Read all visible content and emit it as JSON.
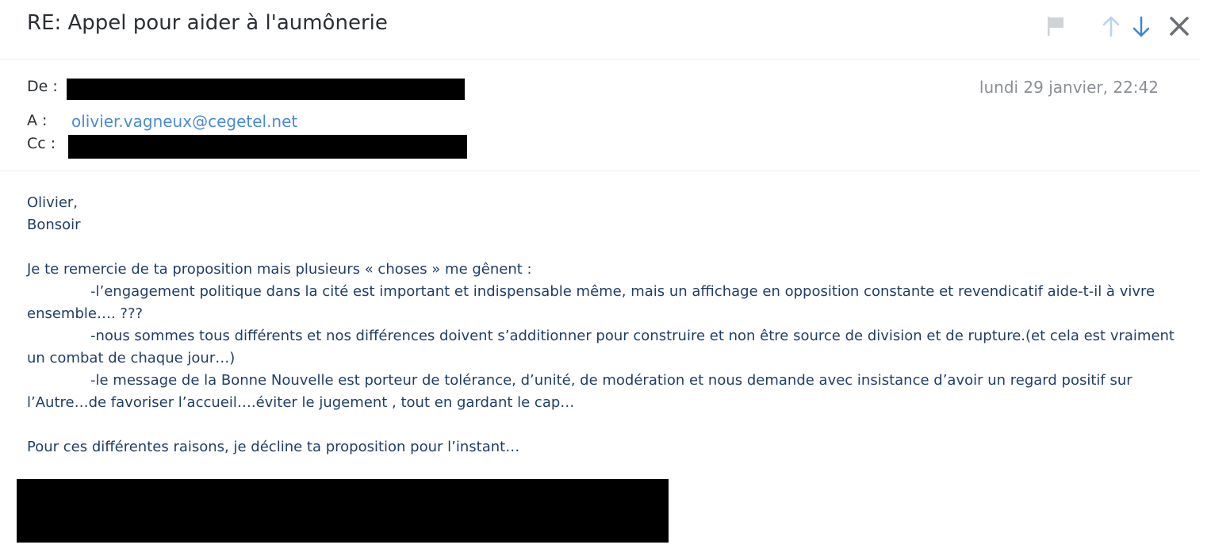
{
  "email": {
    "subject": "RE: Appel pour aider à l'aumônerie",
    "from_label": "De :",
    "to_label": "A :",
    "to_address": "olivier.vagneux@cegetel.net",
    "cc_label": "Cc :",
    "date": "lundi 29 janvier, 22:42"
  },
  "toolbar": {
    "flag_icon": "flag-icon",
    "prev_icon": "arrow-up-icon",
    "next_icon": "arrow-down-icon",
    "close_icon": "close-icon",
    "colors": {
      "flag": "#cfd3d6",
      "prev": "#b8d3f2",
      "next": "#3b86d8",
      "close": "#6b6f73"
    }
  },
  "body": {
    "greeting": "Olivier,",
    "salutation": "Bonsoir",
    "intro": "Je te remercie de ta proposition mais plusieurs « choses » me gênent :",
    "points": [
      "-l’engagement politique dans la cité est  important et indispensable même, mais un affichage en opposition constante et revendicatif aide-t-il à vivre ensemble…. ???",
      "-nous sommes tous différents et nos différences doivent s’additionner pour construire et non être source de division et de rupture.(et cela est vraiment un combat de chaque jour…)",
      "-le message de la Bonne Nouvelle est porteur de tolérance, d’unité, de modération et nous demande avec insistance d’avoir un regard positif sur l’Autre…de favoriser l’accueil….éviter le jugement , tout en gardant le cap…"
    ],
    "conclusion": "Pour ces différentes raisons, je décline ta proposition pour l’instant…"
  }
}
